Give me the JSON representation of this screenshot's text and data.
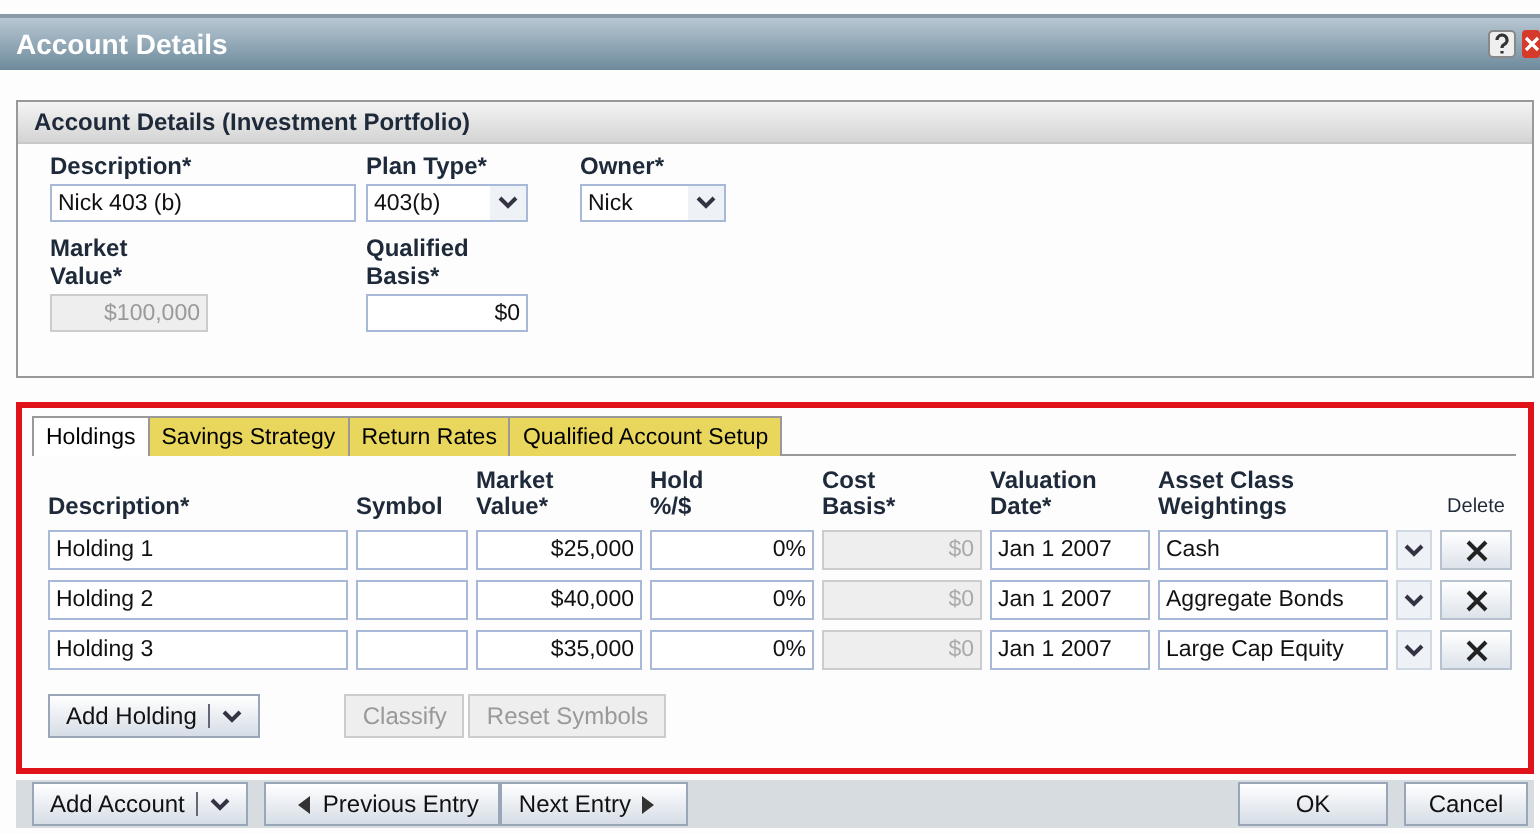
{
  "window": {
    "title": "Account Details"
  },
  "account_section": {
    "title": "Account Details (Investment Portfolio)",
    "description": {
      "label": "Description*",
      "value": "Nick 403 (b)"
    },
    "plan_type": {
      "label": "Plan Type*",
      "value": "403(b)"
    },
    "owner": {
      "label": "Owner*",
      "value": "Nick"
    },
    "market_value": {
      "label": "Market Value*",
      "value": "$100,000",
      "disabled": true
    },
    "qualified_basis": {
      "label": "Qualified Basis*",
      "value": "$0",
      "disabled": false
    }
  },
  "tabs": [
    {
      "label": "Holdings",
      "selected": true
    },
    {
      "label": "Savings Strategy",
      "selected": false
    },
    {
      "label": "Return Rates",
      "selected": false
    },
    {
      "label": "Qualified Account Setup",
      "selected": false
    }
  ],
  "holdings": {
    "columns": [
      "Description*",
      "Symbol",
      "Market Value*",
      "Hold %/$",
      "Cost Basis*",
      "Valuation Date*",
      "Asset Class Weightings",
      "Delete"
    ],
    "rows": [
      {
        "description": "Holding 1",
        "market_value": "$25,000",
        "hold": "0%",
        "cost_basis": "$0",
        "valuation_date": "Jan 1 2007",
        "asset_class": "Cash"
      },
      {
        "description": "Holding 2",
        "market_value": "$40,000",
        "hold": "0%",
        "cost_basis": "$0",
        "valuation_date": "Jan 1 2007",
        "asset_class": "Aggregate Bonds"
      },
      {
        "description": "Holding 3",
        "market_value": "$35,000",
        "hold": "0%",
        "cost_basis": "$0",
        "valuation_date": "Jan 1 2007",
        "asset_class": "Large Cap Equity"
      }
    ],
    "buttons": [
      {
        "label": "Add Holding",
        "kind": "split",
        "disabled": false
      },
      {
        "label": "Classify",
        "kind": "plain",
        "disabled": true
      },
      {
        "label": "Reset Symbols",
        "kind": "plain",
        "disabled": true
      }
    ]
  },
  "footer": {
    "add_account": "Add Account",
    "previous": "Previous Entry",
    "next": "Next Entry",
    "ok": "OK",
    "cancel": "Cancel"
  }
}
